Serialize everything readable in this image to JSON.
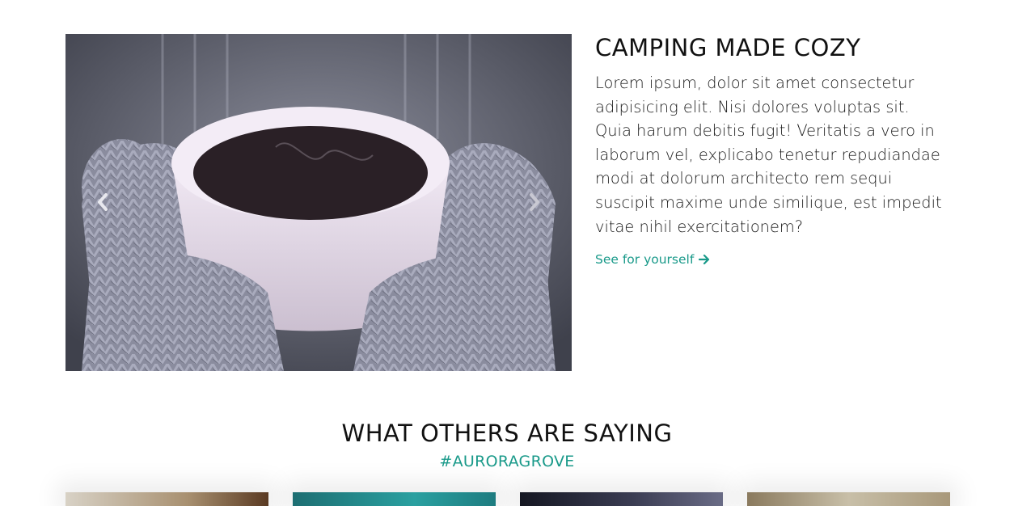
{
  "feature": {
    "title": "CAMPING MADE COZY",
    "body": "Lorem ipsum, dolor sit amet consectetur adipisicing elit. Nisi dolores voluptas sit. Quia harum debitis fugit! Veritatis a vero in laborum vel, explicabo tenetur repudiandae modi at dolorum architecto rem sequi suscipit maxime unde similique, est impedit vitae nihil exercitationem?",
    "link_label": "See for yourself",
    "link_icon": "arrow-right-icon",
    "carousel": {
      "prev_icon": "chevron-left-icon",
      "next_icon": "chevron-right-icon",
      "image": "hands-in-knit-mittens-holding-coffee-cup"
    }
  },
  "social": {
    "heading": "WHAT OTHERS ARE SAYING",
    "hashtag": "#AURORAGROVE",
    "thumbnails": [
      "photo-1",
      "photo-2",
      "photo-3",
      "photo-4"
    ]
  },
  "colors": {
    "accent": "#1a9a8a",
    "text": "#111111",
    "background": "#ffffff"
  }
}
